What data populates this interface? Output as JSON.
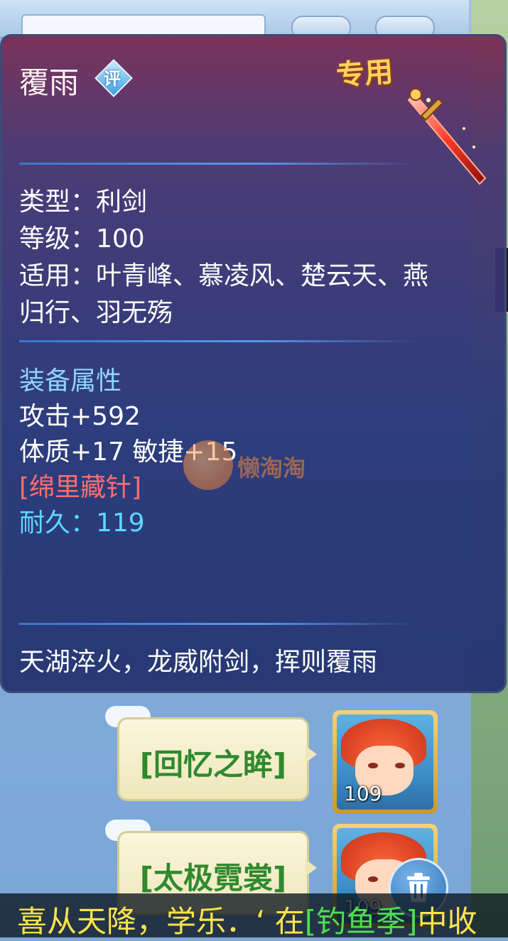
{
  "chat": {
    "messages": [
      {
        "item": "[回忆之眸]",
        "level": "109"
      },
      {
        "item": "[太极霓裳]",
        "level": "109"
      }
    ]
  },
  "marquee": {
    "prefix": "喜从天降，学乐．‘ 在",
    "link": "[钓鱼季]",
    "suffix": "中收"
  },
  "tooltip": {
    "name": "覆雨",
    "rating_badge": "评",
    "exclusive_tag": "专用",
    "type_line": "类型：利剑",
    "level_line": "等级：100",
    "usable_line1": "适用：叶青峰、慕凌风、楚云天、燕",
    "usable_line2": "归行、羽无殇",
    "attr_title": "装备属性",
    "attack": "攻击+592",
    "stats": "体质+17 敏捷+15",
    "special": "[绵里藏针]",
    "durability": "耐久：119",
    "description": "天湖淬火，龙威附剑，挥则覆雨"
  },
  "watermark": {
    "text": "懒淘淘"
  },
  "icons": {
    "rating": "rating-diamond-icon",
    "sword": "sword-icon",
    "trash": "trash-icon"
  },
  "colors": {
    "name": "#fff0f0",
    "exclusive": "#ffd35a",
    "attr_title": "#8fd4ff",
    "special": "#ff6e6e",
    "durability": "#5fd8ff",
    "chat_item": "#2f8a2f",
    "marquee_text": "#ffe34a",
    "marquee_link": "#4ee04e"
  }
}
